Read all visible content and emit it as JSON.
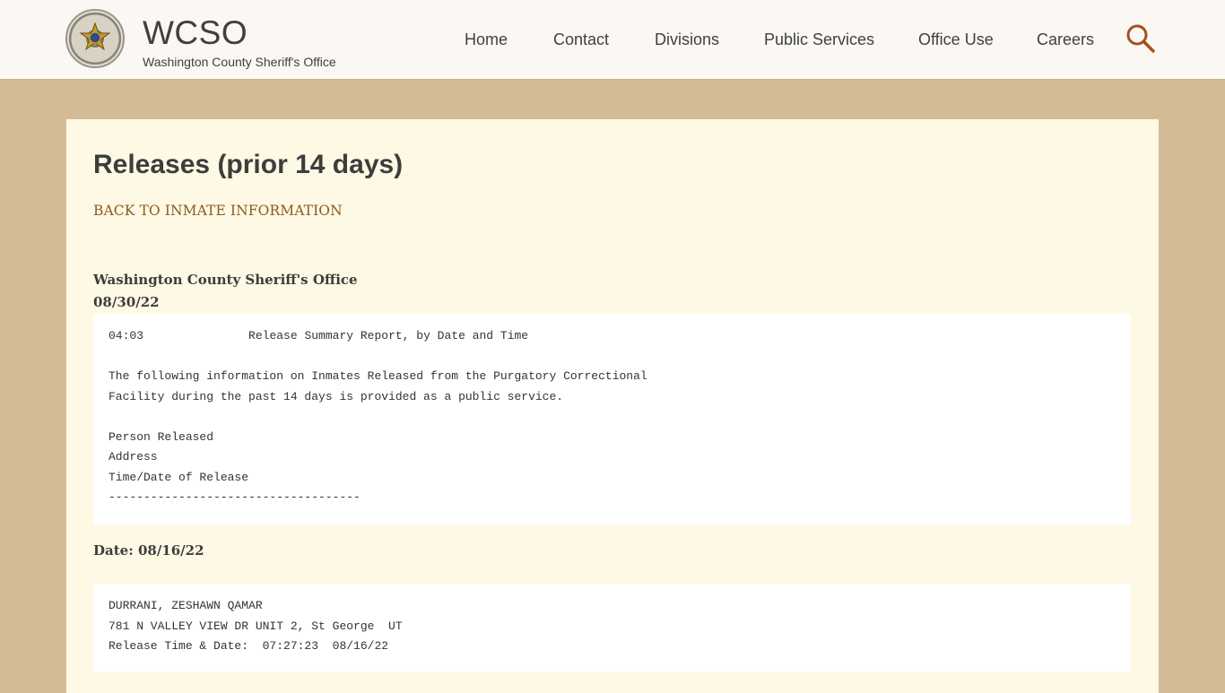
{
  "header": {
    "title": "WCSO",
    "subtitle": "Washington County Sheriff's Office",
    "logo_icon": "sheriff-badge-seal",
    "logo_text": [
      "WASHINGTON COUNTY",
      "SHERIFF"
    ]
  },
  "nav": {
    "items": [
      {
        "label": "Home"
      },
      {
        "label": "Contact"
      },
      {
        "label": "Divisions"
      },
      {
        "label": "Public Services"
      },
      {
        "label": "Office Use"
      },
      {
        "label": "Careers"
      }
    ],
    "search_icon": "search-icon"
  },
  "main": {
    "page_title": "Releases (prior 14 days)",
    "back_link": "BACK TO INMATE INFORMATION",
    "org_name": "Washington County Sheriff's Office",
    "report_date": "08/30/22",
    "report_header": {
      "time": "04:03",
      "report_title": "Release Summary Report, by Date and Time",
      "info_line1": "The following information on Inmates Released from the Purgatory Correctional",
      "info_line2": "Facility during the past 14 days is provided as a public service.",
      "legend_person": "Person Released",
      "legend_address": "Address",
      "legend_time": "Time/Date of Release",
      "separator": "------------------------------------"
    },
    "date_heading": "Date: 08/16/22",
    "releases": [
      {
        "name": "DURRANI, ZESHAWN QAMAR",
        "address": "781 N VALLEY VIEW DR UNIT 2, St George  UT",
        "release_line": "Release Time & Date:  07:27:23  08/16/22"
      }
    ]
  },
  "colors": {
    "page_background": "#d3bc95",
    "header_background": "#fbf8f4",
    "panel_background": "#fef9e4",
    "link": "#8a5a20",
    "search_icon": "#a3501f"
  }
}
